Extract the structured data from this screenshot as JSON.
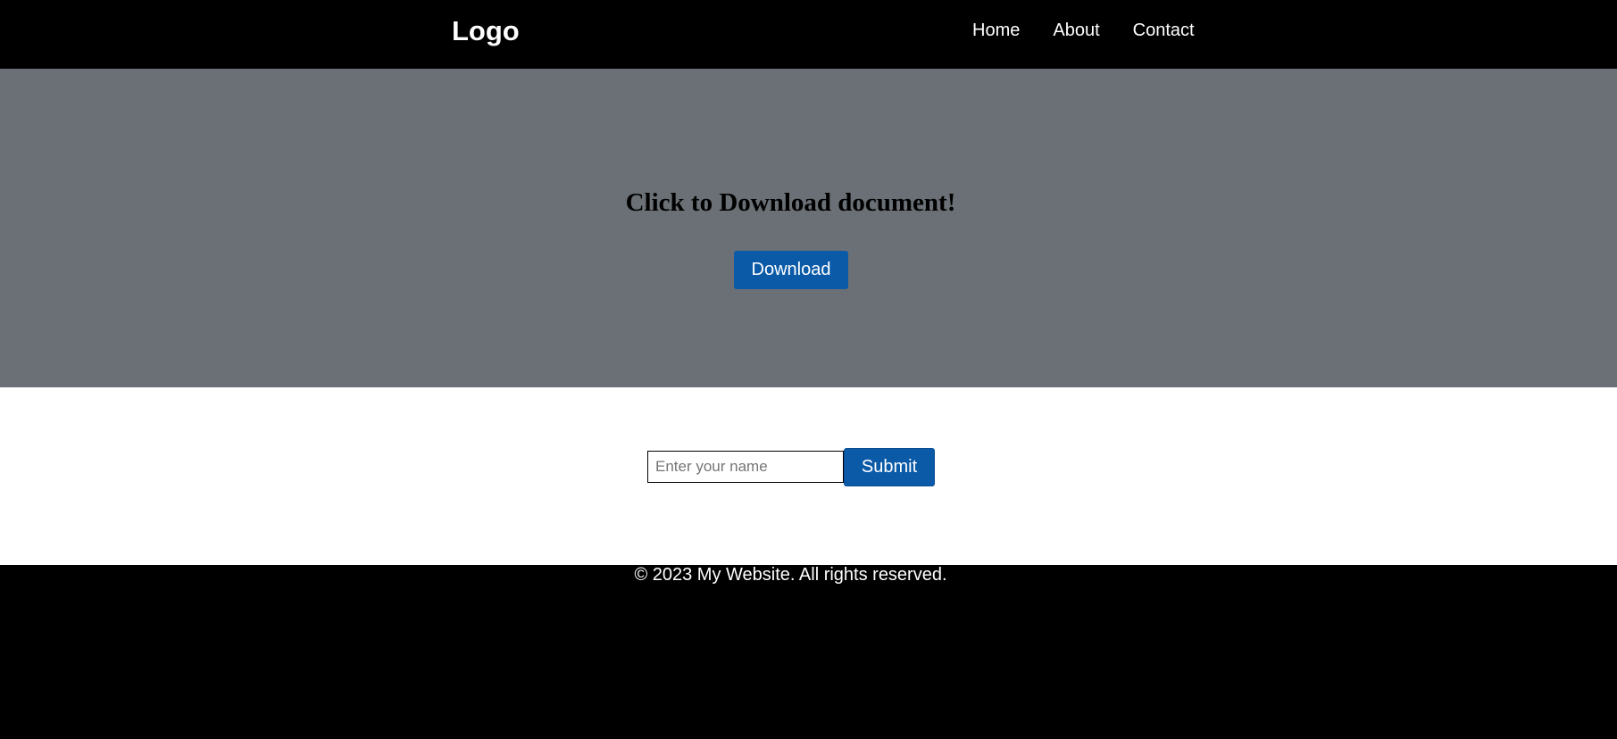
{
  "header": {
    "logo": "Logo",
    "nav": [
      {
        "label": "Home"
      },
      {
        "label": "About"
      },
      {
        "label": "Contact"
      }
    ]
  },
  "hero": {
    "title": "Click to Download document!",
    "download_label": "Download"
  },
  "form": {
    "name_placeholder": "Enter your name",
    "name_value": "",
    "submit_label": "Submit"
  },
  "footer": {
    "text": "© 2023 My Website. All rights reserved."
  },
  "colors": {
    "header_bg": "#000000",
    "hero_bg": "#6a7075",
    "button_bg": "#0b5aa8",
    "form_bg": "#ffffff",
    "footer_bg": "#000000"
  }
}
